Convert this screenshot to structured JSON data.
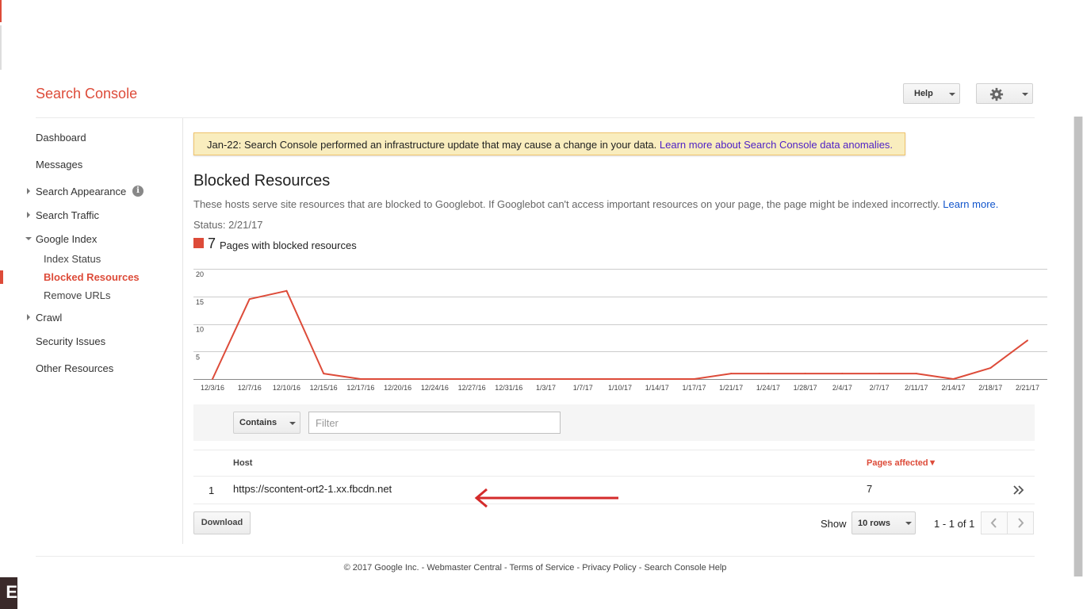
{
  "header": {
    "brand": "Search Console",
    "help_label": "Help",
    "settings_icon": "gear-icon"
  },
  "sidebar": {
    "dashboard": "Dashboard",
    "messages": "Messages",
    "search_appearance": "Search Appearance",
    "search_traffic": "Search Traffic",
    "google_index": "Google Index",
    "index_status": "Index Status",
    "blocked_resources": "Blocked Resources",
    "remove_urls": "Remove URLs",
    "crawl": "Crawl",
    "security_issues": "Security Issues",
    "other_resources": "Other Resources"
  },
  "notice": {
    "text": "Jan-22: Search Console performed an infrastructure update that may cause a change in your data.",
    "link": "Learn more about Search Console data anomalies."
  },
  "main": {
    "title": "Blocked Resources",
    "description": "These hosts serve site resources that are blocked to Googlebot. If Googlebot can't access important resources on your page, the page might be indexed incorrectly.",
    "learn_more": "Learn more.",
    "status": "Status: 2/21/17",
    "legend_count": "7",
    "legend_label": "Pages with blocked resources"
  },
  "chart_data": {
    "type": "line",
    "series": [
      {
        "name": "Pages with blocked resources",
        "color": "#dd4b39",
        "values": [
          0,
          14.5,
          16,
          1,
          0,
          0,
          0,
          0,
          0,
          0,
          0,
          0,
          0,
          0,
          1,
          1,
          1,
          1,
          1,
          1,
          0,
          2,
          7
        ]
      }
    ],
    "x": [
      "12/3/16",
      "12/7/16",
      "12/10/16",
      "12/15/16",
      "12/17/16",
      "12/20/16",
      "12/24/16",
      "12/27/16",
      "12/31/16",
      "1/3/17",
      "1/7/17",
      "1/10/17",
      "1/14/17",
      "1/17/17",
      "1/21/17",
      "1/24/17",
      "1/28/17",
      "2/4/17",
      "2/7/17",
      "2/11/17",
      "2/14/17",
      "2/18/17",
      "2/21/17"
    ],
    "y_ticks": [
      "5",
      "10",
      "15",
      "20"
    ],
    "ylim": [
      0,
      20
    ],
    "grid": true
  },
  "filter": {
    "mode": "Contains",
    "placeholder": "Filter"
  },
  "table": {
    "columns": [
      "Host",
      "Pages affected"
    ],
    "sort_indicator": "▼",
    "rows": [
      {
        "index": "1",
        "host": "https://scontent-ort2-1.xx.fbcdn.net",
        "pages": "7"
      }
    ]
  },
  "pagination": {
    "download": "Download",
    "show": "Show",
    "rows_option": "10 rows",
    "range": "1 - 1 of 1"
  },
  "footer": {
    "copyright": "© 2017 Google Inc.",
    "links": [
      "Webmaster Central",
      "Terms of Service",
      "Privacy Policy",
      "Search Console Help"
    ],
    "separator": " - "
  },
  "misc": {
    "badge_char": "E"
  }
}
